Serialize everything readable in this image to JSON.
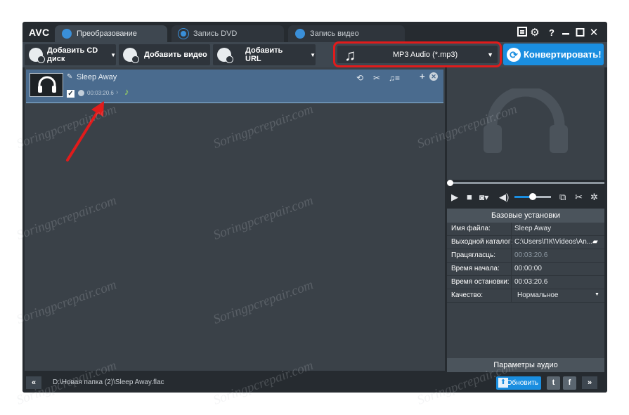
{
  "app": {
    "logo": "AVC"
  },
  "tabs": [
    {
      "label": "Преобразование",
      "icon": "convert-icon",
      "active": true
    },
    {
      "label": "Запись DVD",
      "icon": "disc-icon",
      "active": false
    },
    {
      "label": "Запись видео",
      "icon": "record-icon",
      "active": false
    }
  ],
  "window_buttons": {
    "help": "?"
  },
  "toolbar": {
    "add_cd": "Добавить CD диск",
    "add_video": "Добавить видео",
    "add_url": "Добавить URL"
  },
  "format": {
    "selected": "MP3 Audio (*.mp3)",
    "highlight_color": "#e11b1b"
  },
  "convert": {
    "label": "Конвертировать!",
    "color": "#1a8ee0"
  },
  "file": {
    "name": "Sleep Away",
    "duration": "00:03:20.6",
    "checked": true
  },
  "settings": {
    "header": "Базовые установки",
    "rows": [
      {
        "key": "Имя файла:",
        "value": "Sleep Away"
      },
      {
        "key": "Выходной каталог:",
        "value": "C:\\Users\\ПК\\Videos\\An..."
      },
      {
        "key": "Працягласць:",
        "value": "00:03:20.6"
      },
      {
        "key": "Время начала:",
        "value": "00:00:00"
      },
      {
        "key": "Время остановки:",
        "value": "00:03:20.6"
      },
      {
        "key": "Качество:",
        "value": "Нормальное"
      }
    ],
    "audio_params": "Параметры аудио"
  },
  "player": {
    "volume": 0.5
  },
  "status": {
    "path": "D:\\Новая папка (2)\\Sleep Away.flac",
    "update": "Обновить"
  },
  "watermark": "Soringpcrepair.com"
}
